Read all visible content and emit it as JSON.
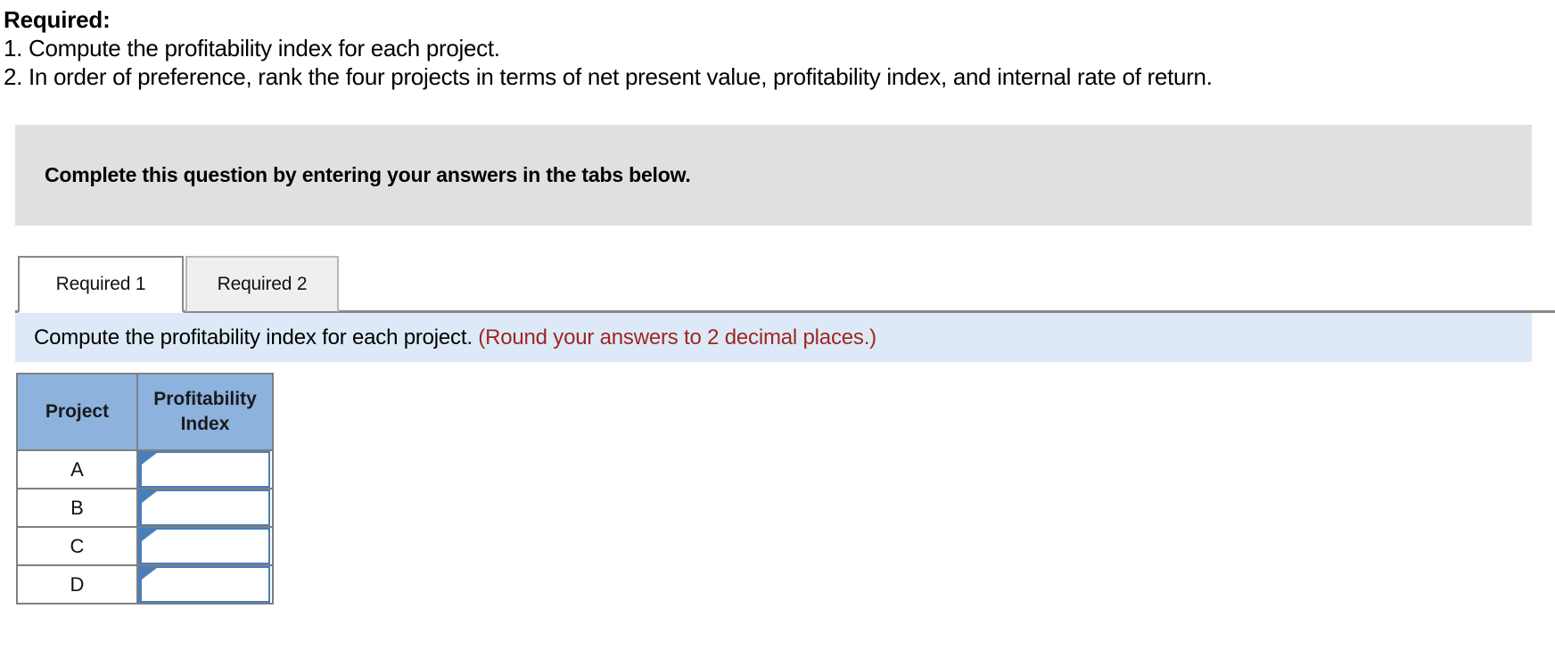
{
  "prompt": {
    "heading": "Required:",
    "line1": "1. Compute the profitability index for each project.",
    "line2": "2. In order of preference, rank the four projects in terms of net present value, profitability index, and internal rate of return."
  },
  "banner": {
    "text": "Complete this question by entering your answers in the tabs below."
  },
  "tabs": [
    {
      "label": "Required 1",
      "active": true
    },
    {
      "label": "Required 2",
      "active": false
    }
  ],
  "instruction": {
    "main": "Compute the profitability index for each project.",
    "note": "(Round your answers to 2 decimal places.)"
  },
  "table": {
    "headers": [
      "Project",
      "Profitability\nIndex"
    ],
    "header_project": "Project",
    "header_index_line1": "Profitability",
    "header_index_line2": "Index",
    "rows": [
      {
        "project": "A",
        "index_value": "",
        "placeholder": ""
      },
      {
        "project": "B",
        "index_value": "",
        "placeholder": ""
      },
      {
        "project": "C",
        "index_value": "",
        "placeholder": ""
      },
      {
        "project": "D",
        "index_value": "",
        "placeholder": ""
      }
    ]
  },
  "colors": {
    "banner_gray": "#e0e0e0",
    "strip_blue": "#dde9f7",
    "note_red": "#9e2622",
    "table_header_blue": "#8cb2dd",
    "input_border_blue": "#4a7ebb",
    "border_gray": "#7f7f7f"
  }
}
